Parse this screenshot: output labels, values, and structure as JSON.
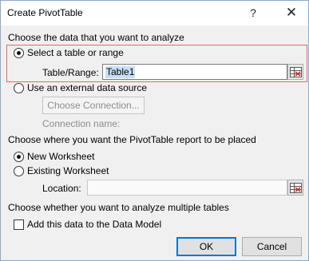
{
  "window": {
    "title": "Create PivotTable",
    "help_label": "?",
    "close_label": "✕"
  },
  "data_section": {
    "heading": "Choose the data that you want to analyze",
    "select_table_label": "Select a table or range",
    "select_table_checked": true,
    "table_range_label": "Table/Range:",
    "table_range_value": "Table1",
    "external_source_label": "Use an external data source",
    "external_source_checked": false,
    "choose_connection_label": "Choose Connection...",
    "connection_name_label": "Connection name:"
  },
  "placement_section": {
    "heading": "Choose where you want the PivotTable report to be placed",
    "new_worksheet_label": "New Worksheet",
    "new_worksheet_checked": true,
    "existing_worksheet_label": "Existing Worksheet",
    "existing_worksheet_checked": false,
    "location_label": "Location:",
    "location_value": ""
  },
  "multiple_tables_section": {
    "heading": "Choose whether you want to analyze multiple tables",
    "data_model_label": "Add this data to the Data Model",
    "data_model_checked": false
  },
  "buttons": {
    "ok_label": "OK",
    "cancel_label": "Cancel"
  },
  "colors": {
    "highlight_border": "#e06a6a",
    "selection_bg": "#c7dff6",
    "default_button_border": "#0078d7"
  },
  "icons": {
    "range_selector": "range-selector-icon",
    "close": "close-icon"
  }
}
